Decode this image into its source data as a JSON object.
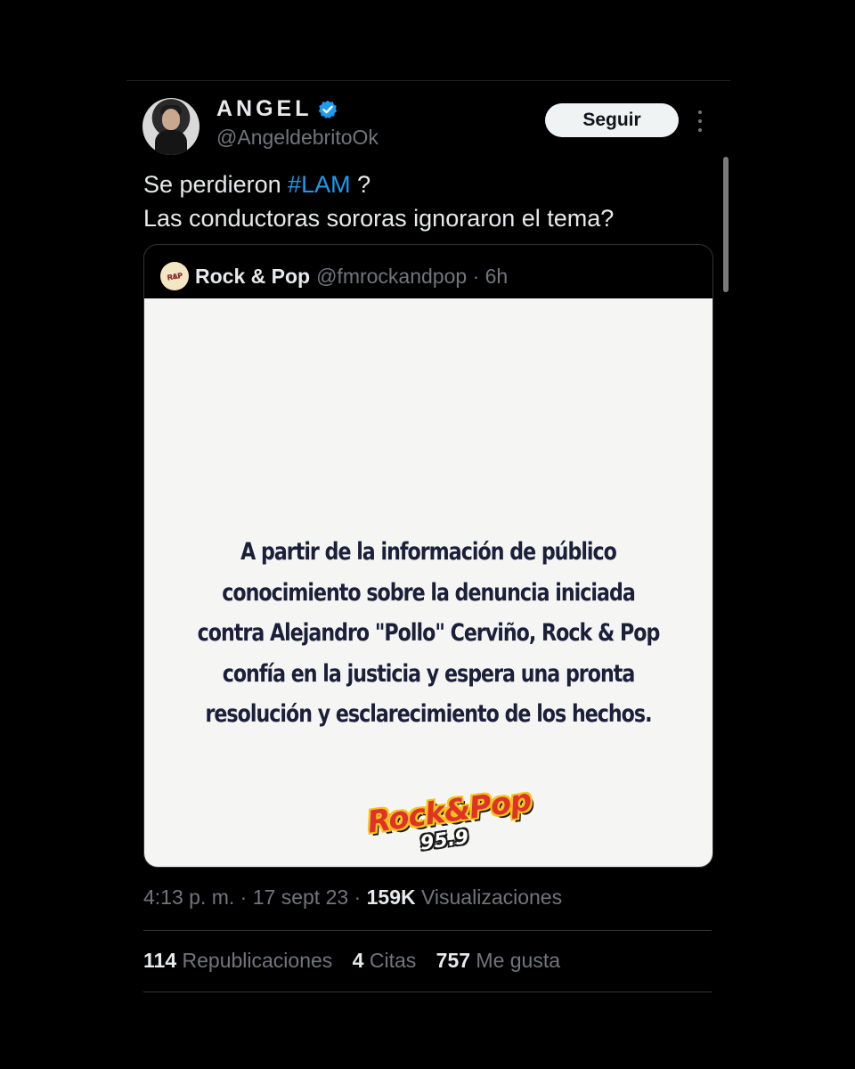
{
  "author": {
    "display_name": "ANGEL",
    "handle": "@AngeldebritoOk",
    "follow_label": "Seguir"
  },
  "tweet": {
    "line1_before": "Se perdieron ",
    "hashtag": "#LAM",
    "line1_after": " ?",
    "line2": "Las conductoras sororas ignoraron el tema?"
  },
  "quote": {
    "name": "Rock & Pop",
    "handle": "@fmrockandpop",
    "separator": " · ",
    "time": "6h",
    "statement": "A partir de la información de público conocimiento sobre la denuncia iniciada contra Alejandro \"Pollo\" Cerviño, Rock & Pop confía en la justicia y espera una pronta resolución y esclarecimiento de los hechos.",
    "statement_lines": [
      "A partir de la información de público",
      "conocimiento sobre la denuncia iniciada",
      "contra Alejandro \"Pollo\" Cerviño, Rock & Pop",
      "confía en la justicia y espera una pronta",
      "resolución y esclarecimiento de los hechos."
    ],
    "logo_text": "Rock&Pop",
    "logo_frequency": "95.9"
  },
  "meta": {
    "time": "4:13 p. m.",
    "date": "17 sept 23",
    "separator": " · ",
    "views_count": "159K",
    "views_label": "Visualizaciones"
  },
  "stats": {
    "reposts_count": "114",
    "reposts_label": "Republicaciones",
    "quotes_count": "4",
    "quotes_label": "Citas",
    "likes_count": "757",
    "likes_label": "Me gusta"
  },
  "colors": {
    "background": "#000000",
    "text": "#e7e9ea",
    "muted": "#71767b",
    "link": "#1d9bf0",
    "verified": "#1d9bf0",
    "statement_text": "#1a1f3a",
    "logo_red": "#e0322a",
    "logo_yellow": "#f5c518"
  },
  "icons": {
    "verified": "verified-badge-icon",
    "more": "more-options-icon"
  }
}
